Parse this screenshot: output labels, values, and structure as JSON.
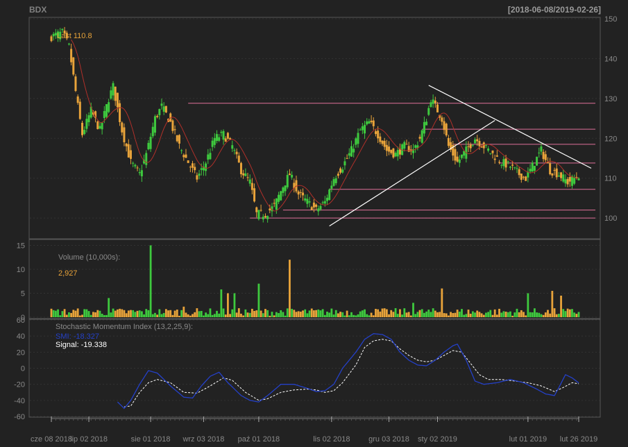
{
  "header": {
    "symbol": "BDX",
    "range": "[2018-06-08/2019-02-26]"
  },
  "chart_data": [
    {
      "type": "candlestick",
      "panel": "price",
      "annotation": {
        "label": "Last",
        "value": "110.8",
        "color": "#e8a33a"
      },
      "yticks": [
        100,
        110,
        120,
        130,
        140,
        150
      ],
      "ylim": [
        95.5,
        150
      ],
      "colors": {
        "up": "#3ec93e",
        "down": "#e8a33a",
        "ma": "#b0302a",
        "hline": "#e0709a",
        "trend": "#ffffff"
      },
      "close_anchors": [
        [
          0,
          145.5
        ],
        [
          5,
          146.5
        ],
        [
          8,
          143
        ],
        [
          12,
          128
        ],
        [
          14,
          121
        ],
        [
          18,
          127
        ],
        [
          22,
          122
        ],
        [
          26,
          130
        ],
        [
          28,
          133
        ],
        [
          32,
          122
        ],
        [
          36,
          114
        ],
        [
          40,
          111
        ],
        [
          43,
          116
        ],
        [
          47,
          125
        ],
        [
          50,
          128
        ],
        [
          54,
          124
        ],
        [
          58,
          118
        ],
        [
          62,
          114
        ],
        [
          66,
          110
        ],
        [
          70,
          114
        ],
        [
          74,
          120
        ],
        [
          78,
          121
        ],
        [
          82,
          118
        ],
        [
          86,
          112
        ],
        [
          90,
          109
        ],
        [
          93,
          101
        ],
        [
          97,
          101
        ],
        [
          101,
          103
        ],
        [
          105,
          108
        ],
        [
          108,
          111
        ],
        [
          112,
          106
        ],
        [
          116,
          104
        ],
        [
          120,
          102
        ],
        [
          124,
          104
        ],
        [
          128,
          110
        ],
        [
          132,
          113
        ],
        [
          136,
          117
        ],
        [
          140,
          122
        ],
        [
          144,
          124
        ],
        [
          148,
          121
        ],
        [
          152,
          117
        ],
        [
          156,
          116
        ],
        [
          160,
          118
        ],
        [
          164,
          117
        ],
        [
          167,
          120
        ],
        [
          170,
          125
        ],
        [
          172,
          130
        ],
        [
          174,
          128
        ],
        [
          177,
          125
        ],
        [
          180,
          118
        ],
        [
          184,
          114
        ],
        [
          188,
          117
        ],
        [
          192,
          120
        ],
        [
          196,
          118
        ],
        [
          200,
          116
        ],
        [
          204,
          114
        ],
        [
          208,
          113
        ],
        [
          212,
          111
        ],
        [
          215,
          110
        ],
        [
          219,
          114
        ],
        [
          222,
          117
        ],
        [
          226,
          112
        ],
        [
          230,
          111
        ],
        [
          234,
          109
        ],
        [
          237,
          110
        ],
        [
          239,
          110.8
        ]
      ],
      "hlines": [
        {
          "y": 128.8,
          "from": 62,
          "to": 239
        },
        {
          "y": 122.3,
          "from": 168,
          "to": 239
        },
        {
          "y": 118.5,
          "from": 182,
          "to": 239
        },
        {
          "y": 113.8,
          "from": 203,
          "to": 239
        },
        {
          "y": 107.2,
          "from": 126,
          "to": 239
        },
        {
          "y": 102.0,
          "from": 105,
          "to": 239
        },
        {
          "y": 100.0,
          "from": 90,
          "to": 239
        }
      ],
      "trendlines": [
        {
          "x1": 126,
          "y1": 98.0,
          "x2": 201,
          "y2": 124.5
        },
        {
          "x1": 171,
          "y1": 133.3,
          "x2": 239,
          "y2": 112.5
        }
      ]
    },
    {
      "type": "bar",
      "panel": "volume",
      "label": "Volume (10,000s):",
      "last": "2,927",
      "yticks": [
        0,
        5,
        10,
        15
      ],
      "ylim": [
        0,
        15.5
      ],
      "spikes": [
        [
          45,
          15
        ],
        [
          108,
          12
        ],
        [
          94,
          7
        ],
        [
          77,
          5.8
        ],
        [
          80,
          5
        ],
        [
          60,
          2.2
        ],
        [
          26,
          4
        ],
        [
          216,
          5
        ],
        [
          227,
          5.5
        ],
        [
          231,
          4.5
        ],
        [
          83,
          5
        ],
        [
          177,
          6
        ],
        [
          164,
          3
        ]
      ]
    },
    {
      "type": "line",
      "panel": "indicator",
      "label": "Stochastic Momentum Index (13,2,25,9):",
      "series": [
        {
          "name": "SMI",
          "value": "-18.327",
          "color": "#2440c8"
        },
        {
          "name": "Signal",
          "value": "-19.338",
          "color": "#ffffff"
        }
      ],
      "yticks": [
        -60,
        -40,
        -20,
        0,
        20,
        40,
        60
      ],
      "ylim": [
        -60,
        60
      ],
      "smi_anchors": [
        [
          30,
          -42
        ],
        [
          33,
          -50
        ],
        [
          36,
          -40
        ],
        [
          40,
          -20
        ],
        [
          44,
          -3
        ],
        [
          48,
          -6
        ],
        [
          54,
          -22
        ],
        [
          60,
          -36
        ],
        [
          64,
          -37
        ],
        [
          68,
          -22
        ],
        [
          72,
          -10
        ],
        [
          76,
          -5
        ],
        [
          80,
          -18
        ],
        [
          86,
          -34
        ],
        [
          90,
          -40
        ],
        [
          94,
          -42
        ],
        [
          98,
          -34
        ],
        [
          104,
          -20
        ],
        [
          110,
          -20
        ],
        [
          116,
          -25
        ],
        [
          120,
          -29
        ],
        [
          124,
          -28
        ],
        [
          128,
          -20
        ],
        [
          132,
          0
        ],
        [
          138,
          20
        ],
        [
          142,
          36
        ],
        [
          146,
          43
        ],
        [
          150,
          42
        ],
        [
          154,
          36
        ],
        [
          158,
          20
        ],
        [
          162,
          10
        ],
        [
          166,
          4
        ],
        [
          170,
          3
        ],
        [
          174,
          10
        ],
        [
          178,
          20
        ],
        [
          182,
          28
        ],
        [
          184,
          30
        ],
        [
          188,
          10
        ],
        [
          192,
          -16
        ],
        [
          196,
          -20
        ],
        [
          202,
          -18
        ],
        [
          208,
          -14
        ],
        [
          214,
          -18
        ],
        [
          220,
          -26
        ],
        [
          224,
          -32
        ],
        [
          228,
          -34
        ],
        [
          230,
          -24
        ],
        [
          233,
          -8
        ],
        [
          236,
          -12
        ],
        [
          239,
          -18.3
        ]
      ],
      "sig_anchors": [
        [
          33,
          -48
        ],
        [
          36,
          -47
        ],
        [
          40,
          -30
        ],
        [
          44,
          -18
        ],
        [
          48,
          -14
        ],
        [
          54,
          -18
        ],
        [
          60,
          -30
        ],
        [
          66,
          -31
        ],
        [
          72,
          -22
        ],
        [
          78,
          -12
        ],
        [
          82,
          -15
        ],
        [
          88,
          -30
        ],
        [
          94,
          -40
        ],
        [
          98,
          -38
        ],
        [
          104,
          -30
        ],
        [
          110,
          -27
        ],
        [
          116,
          -26
        ],
        [
          120,
          -27
        ],
        [
          124,
          -30
        ],
        [
          128,
          -28
        ],
        [
          132,
          -18
        ],
        [
          138,
          4
        ],
        [
          142,
          26
        ],
        [
          146,
          34
        ],
        [
          150,
          36
        ],
        [
          154,
          34
        ],
        [
          158,
          24
        ],
        [
          162,
          16
        ],
        [
          166,
          10
        ],
        [
          170,
          8
        ],
        [
          174,
          10
        ],
        [
          178,
          16
        ],
        [
          182,
          22
        ],
        [
          186,
          20
        ],
        [
          190,
          6
        ],
        [
          194,
          -8
        ],
        [
          198,
          -14
        ],
        [
          204,
          -14
        ],
        [
          210,
          -16
        ],
        [
          216,
          -18
        ],
        [
          222,
          -22
        ],
        [
          228,
          -29
        ],
        [
          232,
          -24
        ],
        [
          236,
          -18
        ],
        [
          239,
          -19.3
        ]
      ]
    }
  ],
  "xaxis": {
    "labels": [
      {
        "i": 0,
        "text": "cze 08 2018"
      },
      {
        "i": 17,
        "text": "lip 02 2018"
      },
      {
        "i": 45,
        "text": "sie 01 2018"
      },
      {
        "i": 69,
        "text": "wrz 03 2018"
      },
      {
        "i": 94,
        "text": "paź 01 2018"
      },
      {
        "i": 127,
        "text": "lis 02 2018"
      },
      {
        "i": 153,
        "text": "gru 03 2018"
      },
      {
        "i": 175,
        "text": "sty 02 2019"
      },
      {
        "i": 216,
        "text": "lut 01 2019"
      },
      {
        "i": 239,
        "text": "lut 26 2019"
      }
    ]
  }
}
